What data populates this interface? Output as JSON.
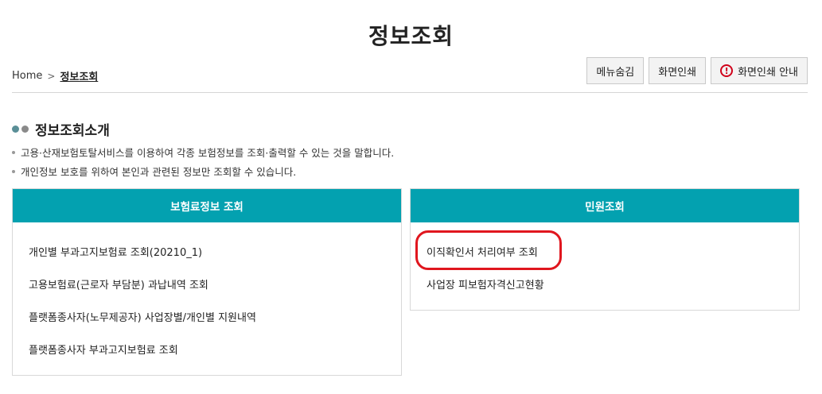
{
  "page": {
    "title": "정보조회"
  },
  "breadcrumb": {
    "home": "Home",
    "separator": ">",
    "current": "정보조회"
  },
  "toolbar": {
    "hide_menu": "메뉴숨김",
    "print": "화면인쇄",
    "print_guide": "화면인쇄 안내",
    "warn_glyph": "!"
  },
  "intro": {
    "title": "정보조회소개",
    "lines": [
      "고용·산재보험토탈서비스를 이용하여 각종 보험정보를 조회·출력할 수 있는 것을 말합니다.",
      "개인정보 보호를 위하여 본인과 관련된 정보만 조회할 수 있습니다."
    ]
  },
  "panels": {
    "insurance": {
      "title": "보험료정보 조회",
      "items": [
        "개인별 부과고지보험료 조회(20210_1)",
        "고용보험료(근로자 부담분) 과납내역 조회",
        "플랫폼종사자(노무제공자) 사업장별/개인별 지원내역",
        "플랫폼종사자 부과고지보험료 조회"
      ]
    },
    "civil": {
      "title": "민원조회",
      "items": [
        "이직확인서 처리여부 조회",
        "사업장 피보험자격신고현황"
      ]
    }
  },
  "colors": {
    "accent": "#03a1b0",
    "highlight": "#e0161e",
    "warn": "#d0021b"
  }
}
